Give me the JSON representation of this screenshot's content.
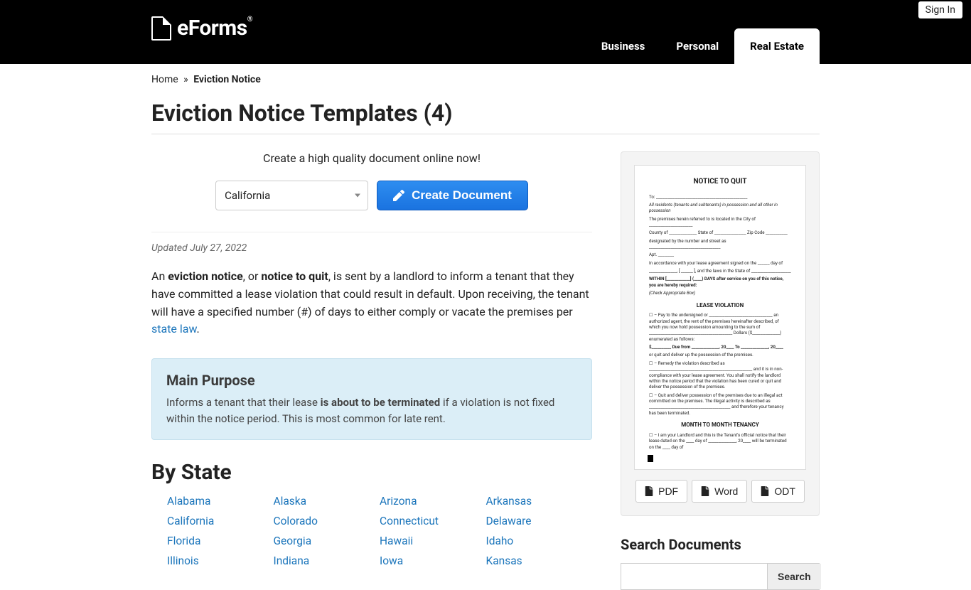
{
  "header": {
    "signin": "Sign In",
    "logo_text": "eForms",
    "nav": {
      "business": "Business",
      "personal": "Personal",
      "real_estate": "Real Estate"
    }
  },
  "breadcrumb": {
    "home": "Home",
    "sep": "»",
    "current": "Eviction Notice"
  },
  "page_title": "Eviction Notice Templates (4)",
  "create": {
    "lead": "Create a high quality document online now!",
    "selected_state": "California",
    "button": "Create Document"
  },
  "updated_label": "Updated July 27, 2022",
  "intro": {
    "pre": "An ",
    "term1": "eviction notice",
    "mid1": ", or ",
    "term2": "notice to quit",
    "rest": ", is sent by a landlord to inform a tenant that they have committed a lease violation that could result in default. Upon receiving, the tenant will have a specified number (#) of days to either comply or vacate the premises per ",
    "link": "state law",
    "end": "."
  },
  "purpose": {
    "title": "Main Purpose",
    "pre": "Informs a tenant that their lease ",
    "bold": "is about to be terminated",
    "post": " if a violation is not fixed within the notice period. This is most common for late rent."
  },
  "by_state_title": "By State",
  "states": [
    "Alabama",
    "Alaska",
    "Arizona",
    "Arkansas",
    "California",
    "Colorado",
    "Connecticut",
    "Delaware",
    "Florida",
    "Georgia",
    "Hawaii",
    "Idaho",
    "Illinois",
    "Indiana",
    "Iowa",
    "Kansas"
  ],
  "sidebar": {
    "downloads": {
      "pdf": "PDF",
      "word": "Word",
      "odt": "ODT"
    },
    "search_title": "Search Documents",
    "search_button": "Search",
    "doc": {
      "title": "NOTICE TO QUIT",
      "to": "To: ______________________________________________",
      "residents": "All residents (tenants and subtenants) in possession and all other in possession",
      "premises": "The premises herein referred to is located in the City of ______________________",
      "county": "County of ______________ State of ________________ Zip Code ___________",
      "designated": "designated by the number and street as ____________________________________",
      "apt": "Apt. ________",
      "accordance": "In accordance with your lease agreement signed on the ______ day of",
      "year_law": "______________, [ ______ ], and the laws in the State of ____________________",
      "within": "WITHIN [____________] (____) DAYS after service on you of this notice, you are hereby required:",
      "check": "(Check Appropriate Box)",
      "sub1": "LEASE VIOLATION",
      "pay1": "☐ – Pay to the undersigned or ________________________________ an authorized agent, the rent of the premises hereinafter described, of which you now hold possession amounting to the sum of __________________________________________ Dollars ($______________) enumerated as follows:",
      "due": "$__________ Due from ______________, 20____ To ______________, 20____",
      "orquit": "or quit and deliver up the possession of the premises.",
      "remedy": "☐ – Remedy the violation described as ____________________________________________________ and it is in non-compliance with your lease agreement. You shall notify the landlord within the notice period that the violation has been cured or quit and deliver the possession of the premises.",
      "illegal": "☐ – Quit and deliver possession of the premises due to an illegal act committed on the premises. The illegal activity is described as _________________________________________ and therefore your tenancy has been terminated.",
      "sub2": "MONTH TO MONTH TENANCY",
      "m2m": "☐ – I am your Landlord and this is the Tenant's official notice that their lease dated on the ____ day of ______________, 20____ will be terminated on the ____ day of"
    }
  }
}
